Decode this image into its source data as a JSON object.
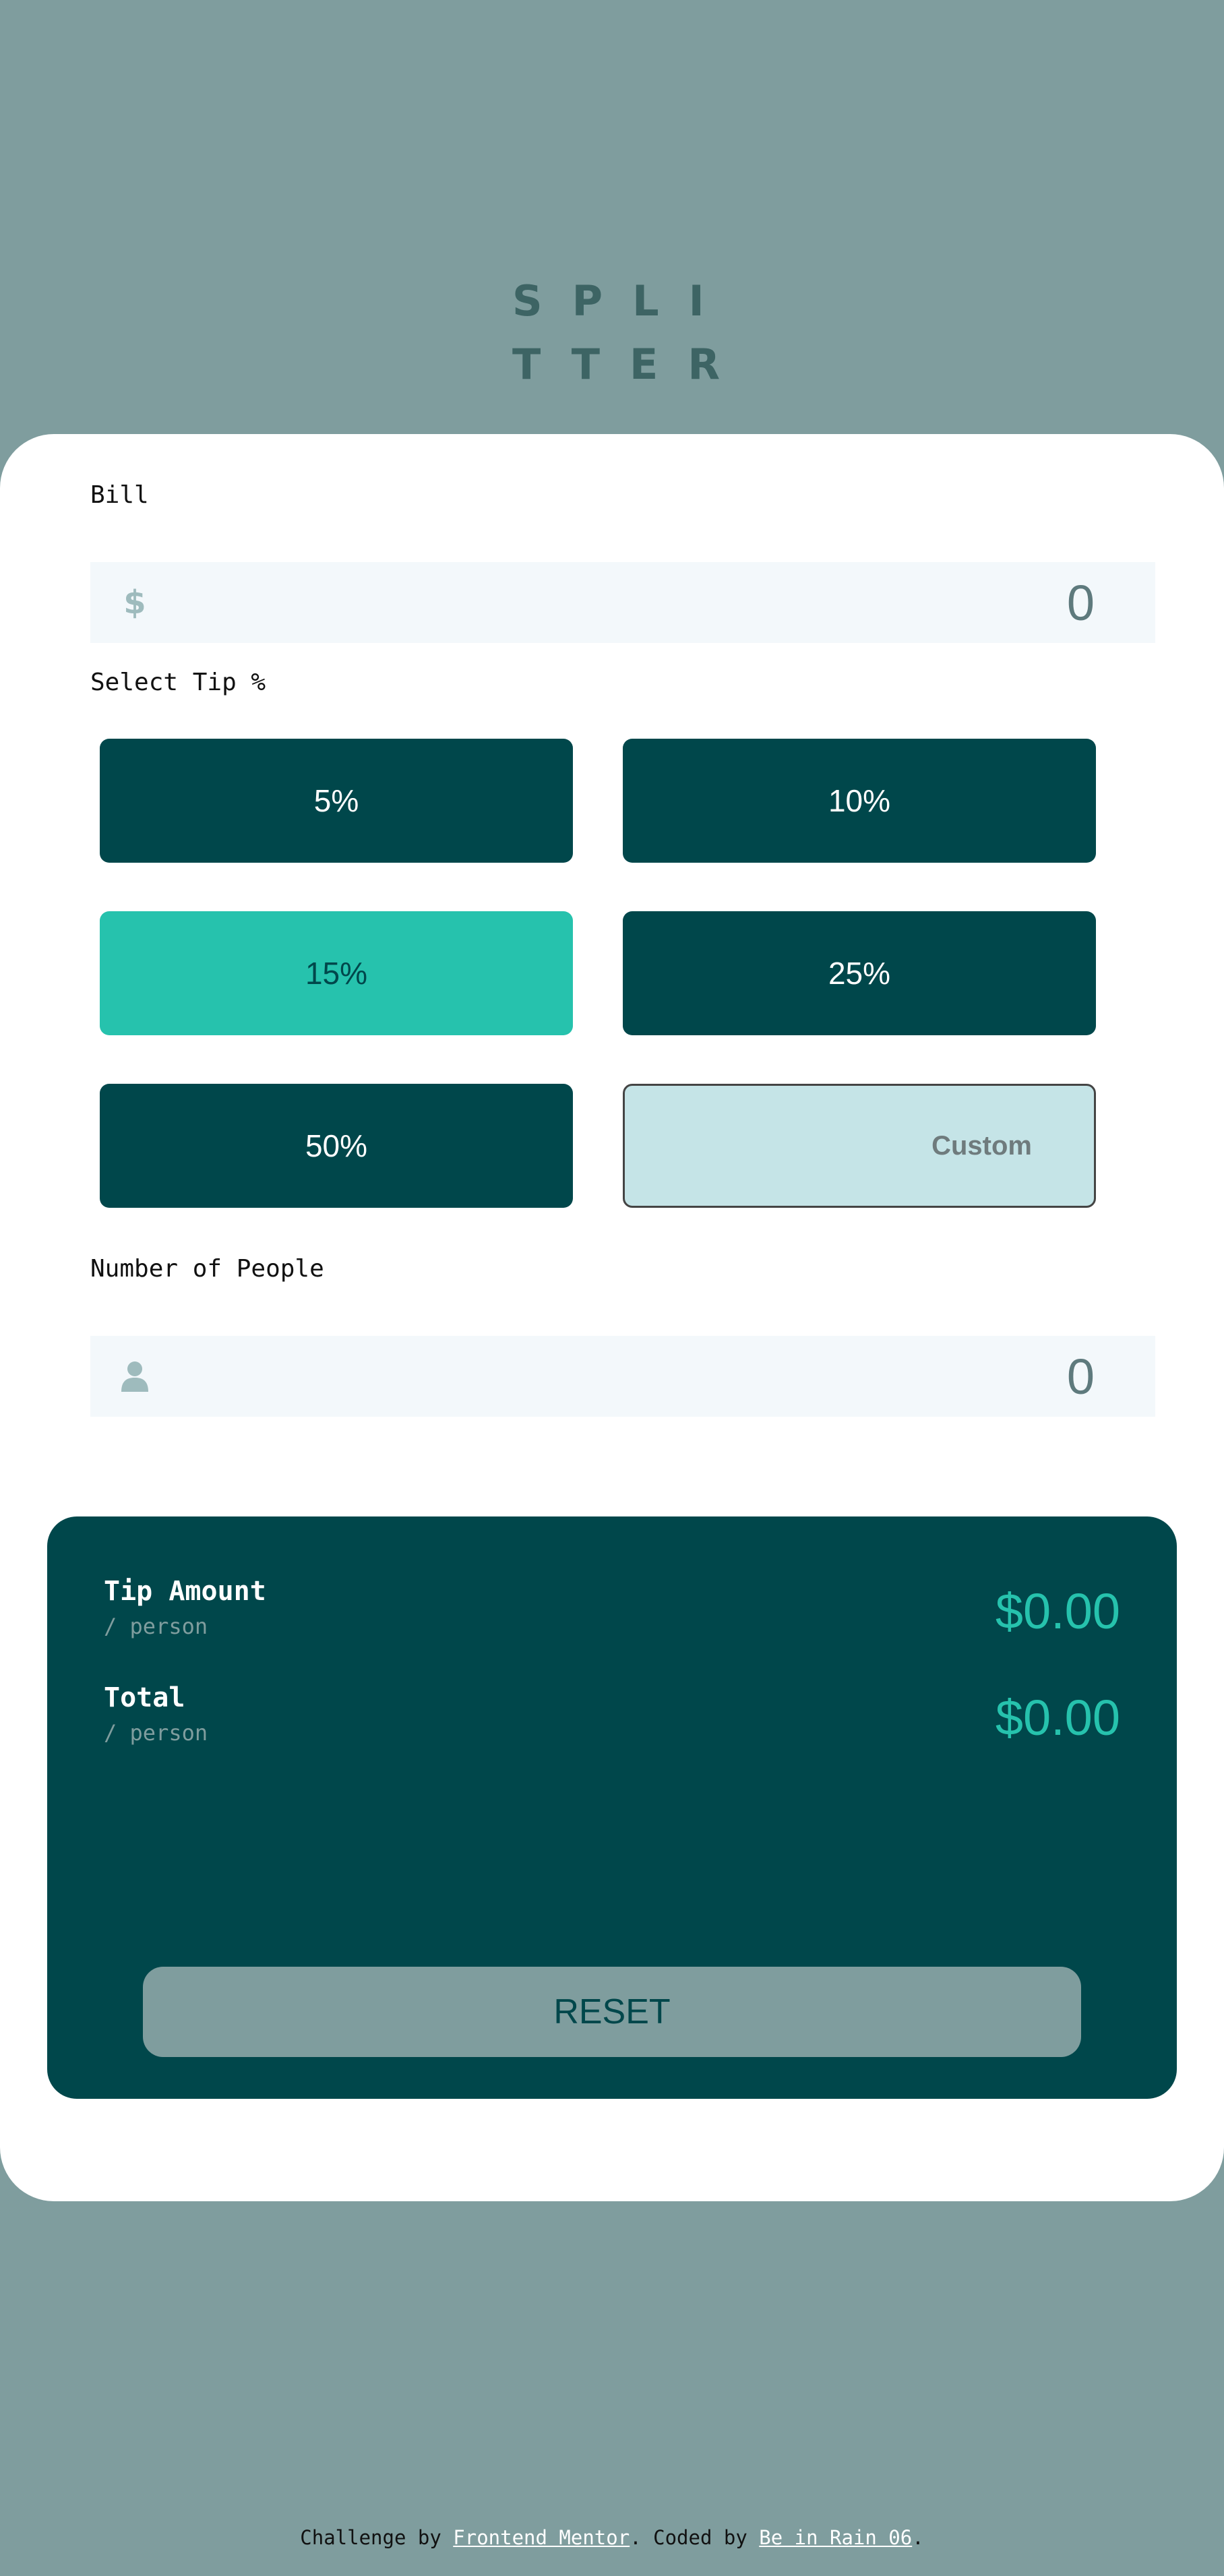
{
  "logo": {
    "line1": "SPLI",
    "line2": "TTER"
  },
  "bill": {
    "label": "Bill",
    "icon": "dollar-icon",
    "value": "0"
  },
  "tip": {
    "label": "Select Tip %",
    "options": [
      "5%",
      "10%",
      "15%",
      "25%",
      "50%"
    ],
    "selected": "15%",
    "custom_placeholder": "Custom"
  },
  "people": {
    "label": "Number of People",
    "icon": "person-icon",
    "value": "0"
  },
  "results": {
    "tip_title": "Tip Amount",
    "tip_sub": "/ person",
    "tip_amount": "$0.00",
    "total_title": "Total",
    "total_sub": "/ person",
    "total_amount": "$0.00",
    "reset_label": "RESET"
  },
  "footer": {
    "prefix": "Challenge by ",
    "link1": "Frontend Mentor",
    "middle": ". Coded by ",
    "link2": "Be in Rain 06",
    "suffix": "."
  },
  "colors": {
    "background": "#7f9d9e",
    "dark_cyan": "#00474b",
    "strong_cyan": "#26c2ad",
    "light_cyan": "#c5e4e7",
    "input_bg": "#f3f8fb"
  }
}
